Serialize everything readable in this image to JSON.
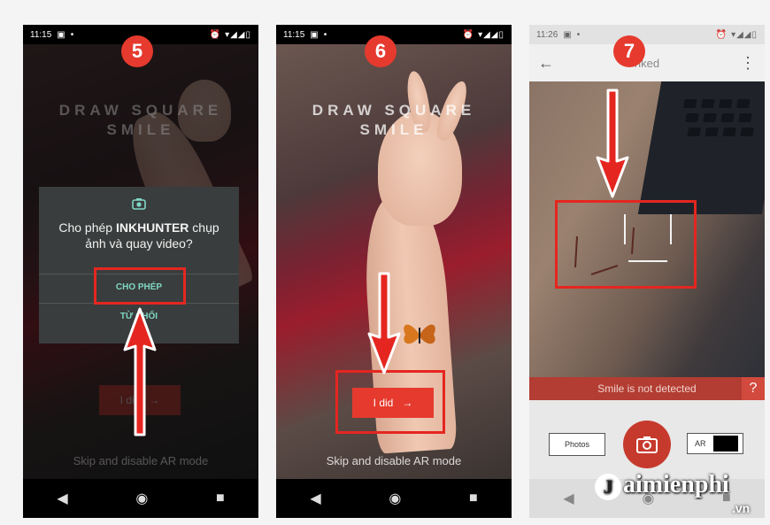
{
  "steps": [
    "5",
    "6",
    "7"
  ],
  "screen1": {
    "time": "11:15",
    "status_icons": "⏰ ▾◢◢▯",
    "app_title_line1": "DRAW SQUARE",
    "app_title_line2": "SMILE",
    "dialog": {
      "message_prefix": "Cho phép ",
      "app_name": "INKHUNTER",
      "message_suffix": " chụp ảnh và quay video?",
      "allow_label": "CHO PHÉP",
      "deny_label": "TỪ CHỐI"
    },
    "button_label": "I did",
    "skip_label": "Skip and disable AR mode"
  },
  "screen2": {
    "time": "11:15",
    "status_icons": "⏰ ▾◢◢▯",
    "app_title_line1": "DRAW SQUARE",
    "app_title_line2": "SMILE",
    "button_label": "I did",
    "skip_label": "Skip and disable AR mode"
  },
  "screen3": {
    "time": "11:26",
    "status_icons": "⏰ ▾◢◢▯",
    "title_partial": "nked",
    "status_message": "Smile is not detected",
    "help_label": "?",
    "photos_label": "Photos",
    "ar_label": "AR"
  },
  "watermark": {
    "brand": "aimienphi",
    "suffix": ".vn"
  },
  "colors": {
    "accent_red": "#e63a2e",
    "highlight_box": "#e52620",
    "dialog_teal": "#7fd7c4"
  }
}
